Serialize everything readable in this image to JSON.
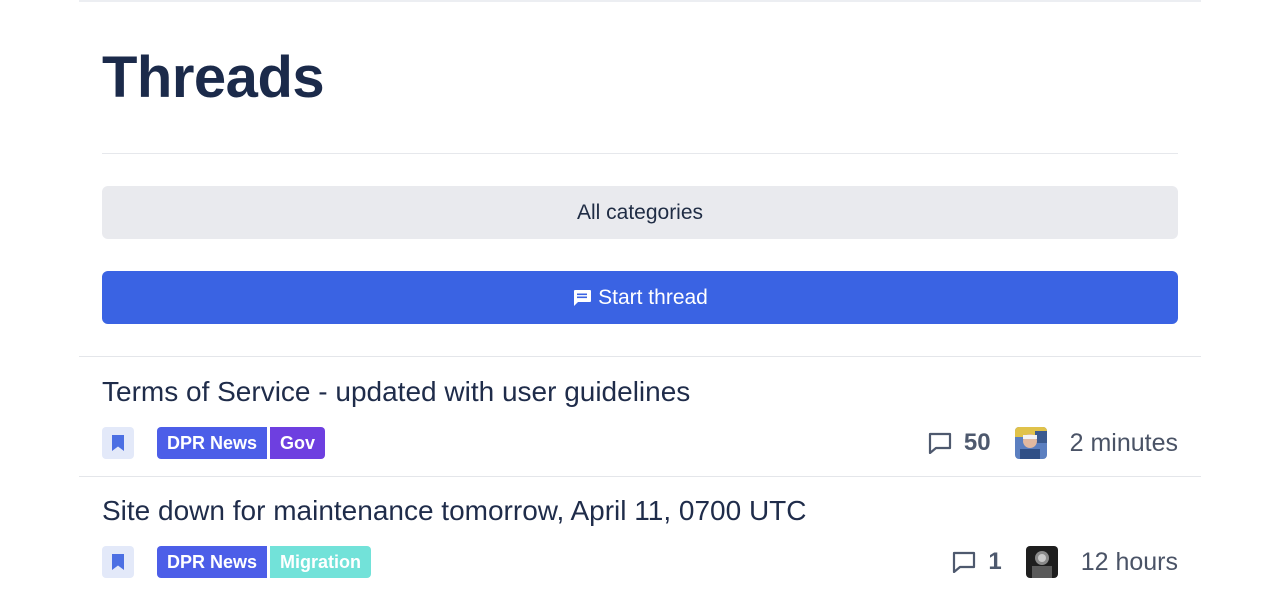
{
  "page": {
    "title": "Threads"
  },
  "filters": {
    "categories_label": "All categories"
  },
  "actions": {
    "start_thread_label": "Start thread",
    "start_thread_icon": "message-square-icon"
  },
  "colors": {
    "primary": "#3a63e3",
    "tag_dpr_news": "#4c5ee8",
    "tag_gov": "#6e3fe0",
    "tag_migration": "#72e2d9"
  },
  "threads": [
    {
      "title": "Terms of Service - updated with user guidelines",
      "tags": [
        {
          "label": "DPR News",
          "color": "#4c5ee8"
        },
        {
          "label": "Gov",
          "color": "#6e3fe0"
        }
      ],
      "replies": "50",
      "time": "2 minutes"
    },
    {
      "title": "Site down for maintenance tomorrow, April 11, 0700 UTC",
      "tags": [
        {
          "label": "DPR News",
          "color": "#4c5ee8"
        },
        {
          "label": "Migration",
          "color": "#72e2d9"
        }
      ],
      "replies": "1",
      "time": "12 hours"
    }
  ]
}
